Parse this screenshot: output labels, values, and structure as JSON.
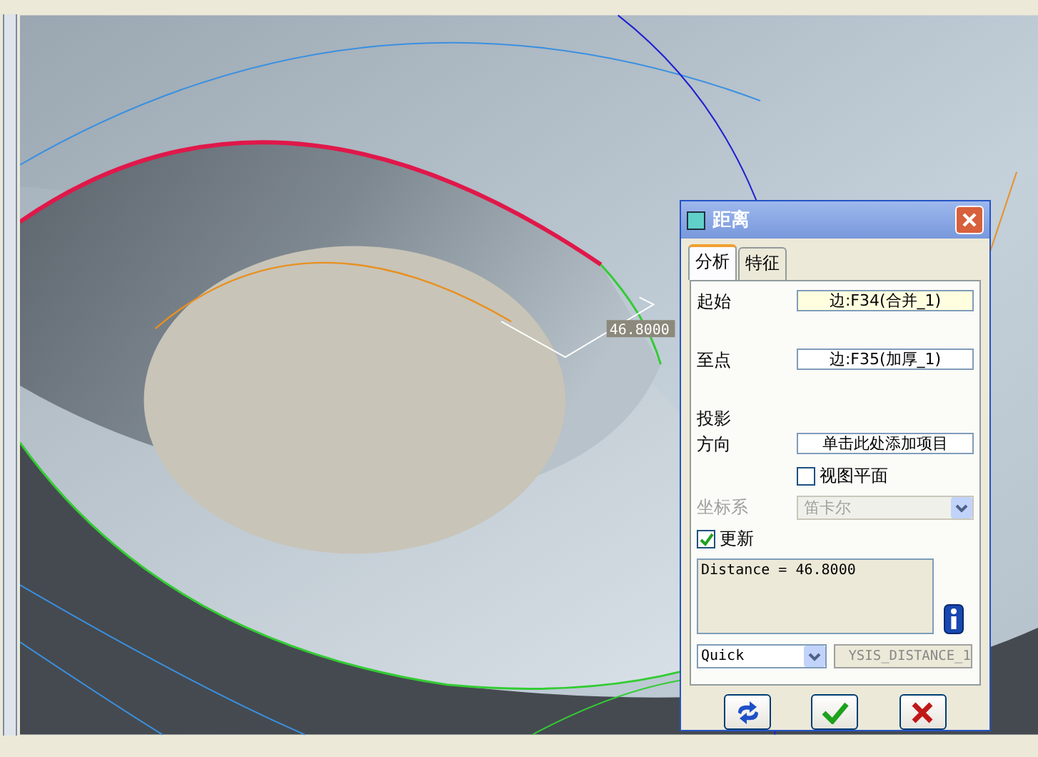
{
  "viewport": {
    "dimension_label": "46.8000"
  },
  "dialog": {
    "title": "距离",
    "tabs": [
      {
        "label": "分析",
        "selected": true
      },
      {
        "label": "特征",
        "selected": false
      }
    ],
    "fields": [
      {
        "label": "起始",
        "value": "边:F34(合并_1)",
        "active": true
      },
      {
        "label": "至点",
        "value": "边:F35(加厚_1)",
        "active": false
      }
    ],
    "projection_label": "投影",
    "direction": {
      "label": "方向",
      "value": "单击此处添加项目"
    },
    "view_plane": {
      "label": "视图平面",
      "checked": false
    },
    "coord_system": {
      "label": "坐标系",
      "value": "笛卡尔",
      "disabled": true
    },
    "update": {
      "label": "更新",
      "checked": true
    },
    "result": "Distance = 46.8000",
    "mode": {
      "value": "Quick"
    },
    "name_field": {
      "value": "YSIS_DISTANCE_1"
    }
  }
}
